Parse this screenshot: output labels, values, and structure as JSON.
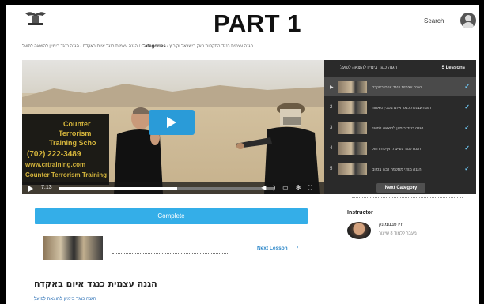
{
  "header": {
    "logo_icon": "emblem-logo-icon",
    "banner": "PART 1",
    "search_label": "Search",
    "avatar_icon": "user-avatar-icon"
  },
  "breadcrumb": {
    "prefix": "הגנה עצמית כנגד איום באקדח / הגנה כנגד בימיון להוצאה לפועל / ",
    "categories": "Categories",
    "suffix": " / הגנה עצמית כנגד התקפות נשק בישראל וקיבוץ"
  },
  "video": {
    "sign_lines": [
      "Counter",
      "Terrorism",
      "Training Scho",
      "(702) 222-3489",
      "www.crtraining.com",
      "Counter Terrorism Training"
    ],
    "current_time": "7:13",
    "progress": 0.55,
    "play_icon": "play-icon",
    "control_icons": [
      "volume-icon",
      "closed-captions-icon",
      "settings-icon",
      "fullscreen-icon"
    ]
  },
  "lessons": {
    "header_title": "הגנה כנגד בימיון להוצאה לפועל",
    "count_label": "5 Lessons",
    "items": [
      {
        "num": "",
        "title": "הגנה עצמית כנגד איום באקדח",
        "active": true,
        "check_icon": "check-icon"
      },
      {
        "num": "2",
        "title": "הגנה עצמית כנגד איום בסכין מאחור",
        "active": false,
        "check_icon": "check-icon"
      },
      {
        "num": "3",
        "title": "הגנה כנגד בימיון להוצאה לפועל",
        "active": false,
        "check_icon": "check-icon"
      },
      {
        "num": "4",
        "title": "הגנה כנגד מניעת תקיפה רחוק",
        "active": false,
        "check_icon": "check-icon"
      },
      {
        "num": "5",
        "title": "הגנה מפני מתקפה רבה בסיום",
        "active": false,
        "check_icon": "check-icon"
      }
    ],
    "next_category": "Next Category"
  },
  "complete_button": "Complete",
  "next_lesson": {
    "label": "Next Lesson",
    "arrow_icon": "chevron-right-icon"
  },
  "instructor": {
    "label": "Instructor",
    "name": "זיו פבנומינק",
    "subtitle": "מעבר ללמוד 8 שיעור"
  },
  "course": {
    "title": "הגנה עצמית כנגד איום באקדח",
    "link": "הגנה כנגד בימיון להוצאה לפועל"
  },
  "colors": {
    "accent": "#34aee8",
    "play_button": "#2a9bd8",
    "link": "#2a86c8",
    "sidebar_bg": "#2a2a2a",
    "check": "#6ec6f2"
  }
}
